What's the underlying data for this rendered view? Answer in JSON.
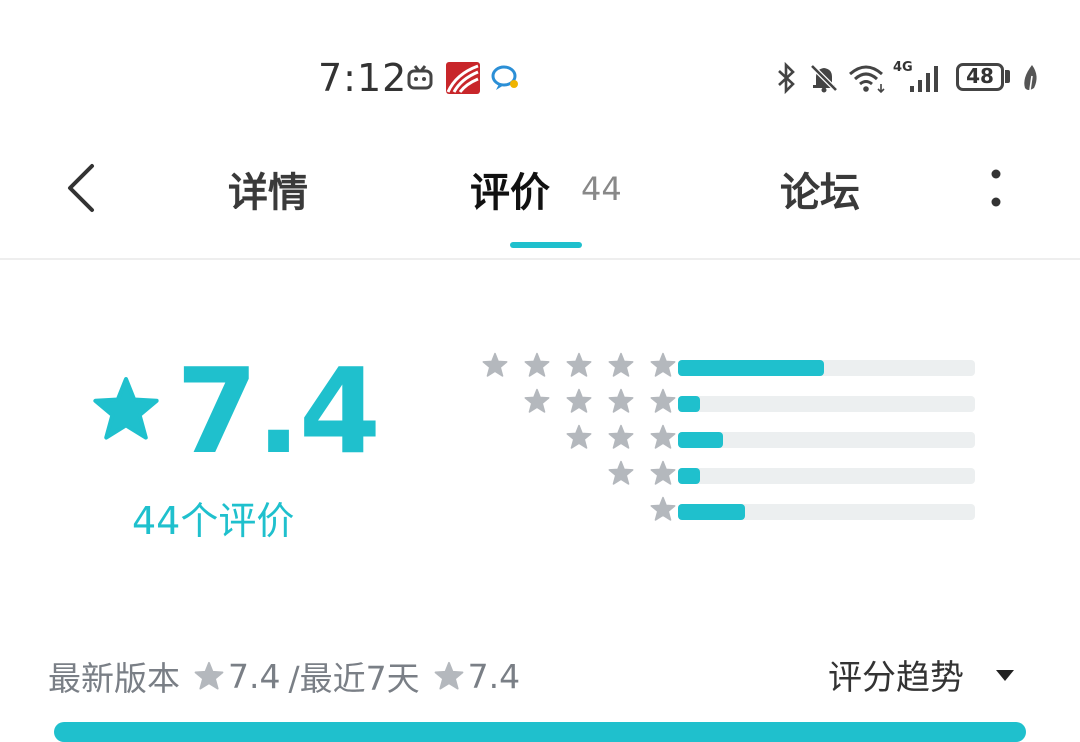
{
  "status_bar": {
    "time": "7:12",
    "network": "4G",
    "battery": "48",
    "icons": [
      "tv-icon",
      "app-icon",
      "chat-icon",
      "bluetooth-icon",
      "bell-muted-icon",
      "wifi-icon",
      "signal-icon",
      "battery-icon",
      "leaf-icon"
    ]
  },
  "nav": {
    "back_icon": "chevron-left-icon",
    "tabs": [
      {
        "label": "详情",
        "active": false
      },
      {
        "label": "评价",
        "count": "44",
        "active": true
      },
      {
        "label": "论坛",
        "active": false
      }
    ],
    "more_icon": "more-vertical-icon"
  },
  "rating": {
    "score": "7.4",
    "count_label": "44个评价",
    "distribution": [
      {
        "stars": 5,
        "fraction": 0.49
      },
      {
        "stars": 4,
        "fraction": 0.075
      },
      {
        "stars": 3,
        "fraction": 0.15
      },
      {
        "stars": 2,
        "fraction": 0.075
      },
      {
        "stars": 1,
        "fraction": 0.225
      }
    ]
  },
  "version_info": {
    "latest_label": "最新版本",
    "latest_score": "7.4",
    "recent_label": "/最近7天",
    "recent_score": "7.4"
  },
  "trend": {
    "label": "评分趋势"
  },
  "colors": {
    "accent": "#1fc0cd",
    "star_gray": "#b4b8bd",
    "track": "#eceff0"
  }
}
